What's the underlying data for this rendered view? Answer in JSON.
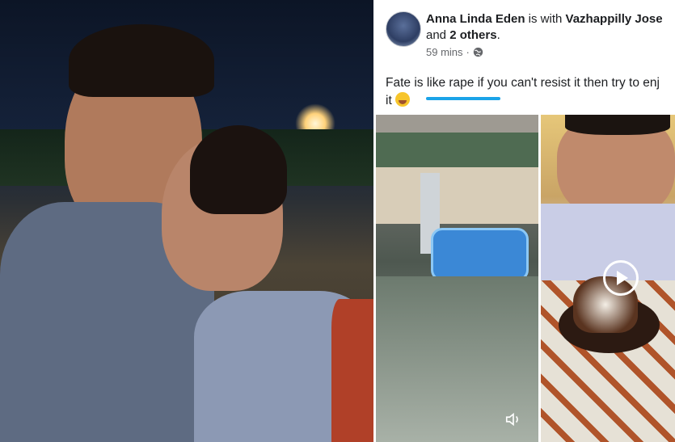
{
  "post": {
    "poster_name": "Anna Linda Eden",
    "with_text": " is with ",
    "tagged_name": "Vazhappilly Jose",
    "and_text": " and ",
    "others": "2 others",
    "period": ".",
    "time": "59 mins",
    "privacy_separator": "·",
    "text": "Fate is like rape if you can't resist it then try to enj",
    "text_line2": "it"
  },
  "icons": {
    "privacy": "globe-icon",
    "play": "play-icon",
    "sound": "speaker-icon",
    "emoji": "laughing-emoji-icon"
  }
}
